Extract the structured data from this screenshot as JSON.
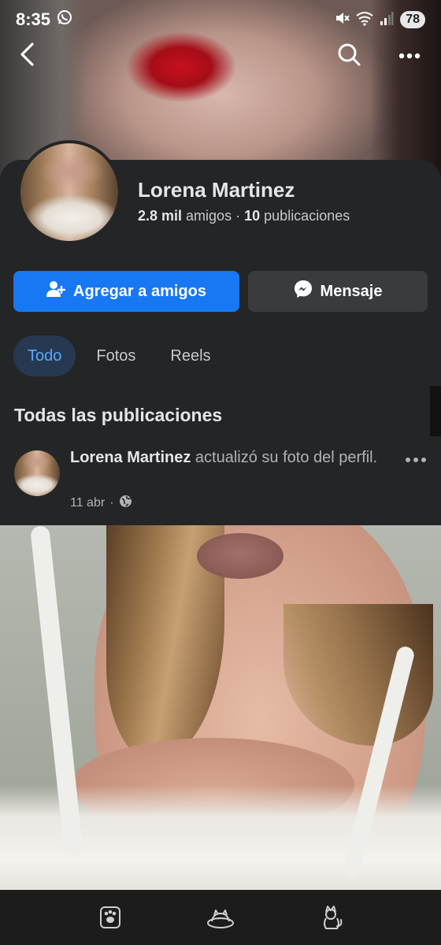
{
  "status_bar": {
    "time": "8:35",
    "battery": "78",
    "icons": [
      "whatsapp-icon",
      "mute-icon",
      "wifi-icon",
      "signal-icon"
    ]
  },
  "top_nav": {
    "back_icon": "chevron-left-icon",
    "search_icon": "search-icon",
    "more_icon": "more-horizontal-icon"
  },
  "profile": {
    "name": "Lorena Martinez",
    "friends_count": "2.8 mil",
    "friends_label": "amigos",
    "separator": "·",
    "posts_count": "10",
    "posts_label": "publicaciones"
  },
  "actions": {
    "add_friend_label": "Agregar a amigos",
    "message_label": "Mensaje"
  },
  "tabs": [
    {
      "label": "Todo",
      "active": true
    },
    {
      "label": "Fotos",
      "active": false
    },
    {
      "label": "Reels",
      "active": false
    }
  ],
  "section": {
    "title": "Todas las publicaciones"
  },
  "post": {
    "author": "Lorena Martinez",
    "action_text": "actualizó su foto del perfil.",
    "date": "11 abr",
    "dot": "·",
    "privacy_icon": "globe-icon"
  },
  "bottom_bar": {
    "icons": [
      "paw-badge-icon",
      "cat-sleeping-icon",
      "cat-sitting-icon"
    ]
  },
  "colors": {
    "background": "#242526",
    "primary_blue": "#1877f2",
    "secondary_button": "#3a3b3c",
    "active_tab_bg": "#263951",
    "active_tab_text": "#5aa7ff"
  }
}
